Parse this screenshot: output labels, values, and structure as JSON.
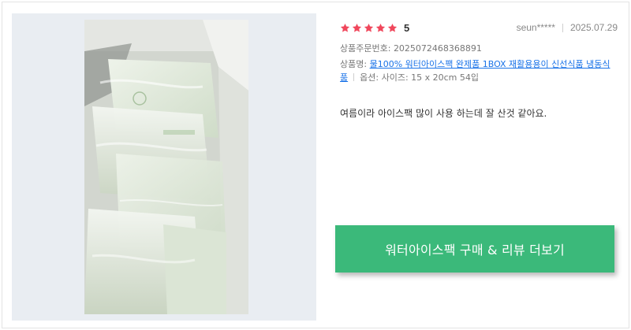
{
  "review": {
    "rating": 5,
    "score_text": "5",
    "username": "seun*****",
    "date": "2025.07.29",
    "order_label": "상품주문번호:",
    "order_number": "2025072468368891",
    "product_label": "상품명:",
    "product_name": "물100% 워터아이스팩 완제품 1BOX 재활용용이 신선식품 냉동식품",
    "option_label": "옵션:",
    "option_value": "사이즈: 15 x 20cm 54입",
    "text": "여름이라 아이스팩 많이 사용 하는데 잘 산것 같아요."
  },
  "cta": {
    "label": "워터아이스팩 구매 & 리뷰 더보기"
  },
  "colors": {
    "star": "#f0475c",
    "cta_bg": "#3bb97a",
    "link": "#1a73e8"
  },
  "icons": {
    "star": "star-icon"
  }
}
